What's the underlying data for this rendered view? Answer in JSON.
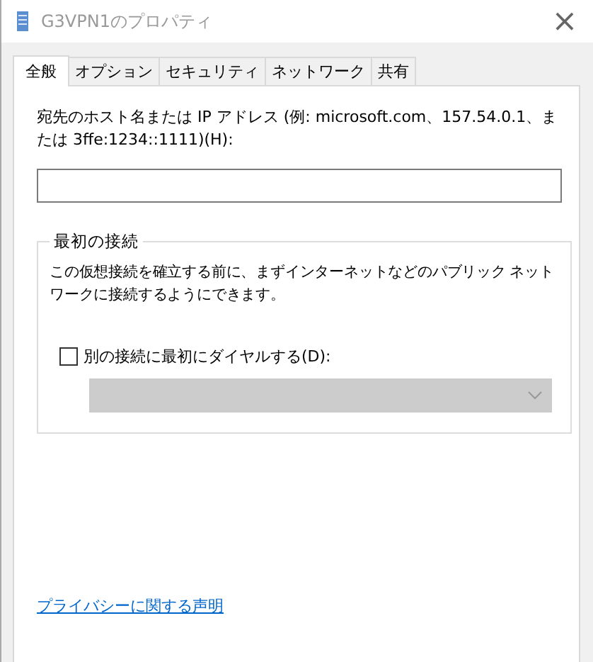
{
  "window": {
    "title": "G3VPN1のプロパティ",
    "close": "×"
  },
  "tabs": [
    {
      "label": "全般",
      "selected": true
    },
    {
      "label": "オプション",
      "selected": false
    },
    {
      "label": "セキュリティ",
      "selected": false
    },
    {
      "label": "ネットワーク",
      "selected": false
    },
    {
      "label": "共有",
      "selected": false
    }
  ],
  "host": {
    "label": "宛先のホスト名または IP アドレス (例: microsoft.com、157.54.0.1、または 3ffe:1234::1111)(H):"
  },
  "first_connection": {
    "title": "最初の接続",
    "description": "この仮想接続を確立する前に、まずインターネットなどのパブリック ネットワークに接続するようにできます。",
    "checkbox": {
      "label": "別の接続に最初にダイヤルする(D):",
      "checked": false
    },
    "dropdown": {
      "disabled": true
    }
  },
  "privacy_link": "プライバシーに関する声明"
}
